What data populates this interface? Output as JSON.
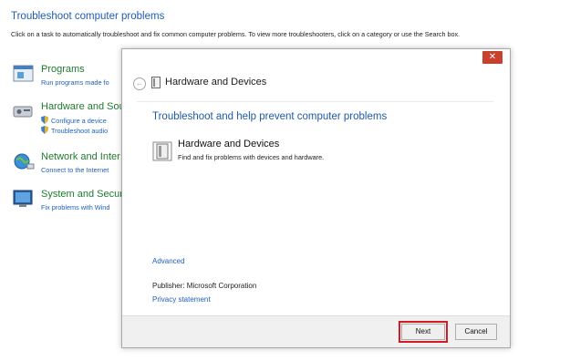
{
  "page": {
    "title": "Troubleshoot computer problems",
    "subtitle": "Click on a task to automatically troubleshoot and fix common computer problems. To view more troubleshooters, click on a category or use the Search box."
  },
  "categories": [
    {
      "title": "Programs",
      "links": [
        "Run programs made fo"
      ]
    },
    {
      "title": "Hardware and Sou",
      "links": [
        "Configure a device",
        "Troubleshoot audio"
      ]
    },
    {
      "title": "Network and Inter",
      "links": [
        "Connect to the Internet"
      ]
    },
    {
      "title": "System and Secur",
      "links": [
        "Fix problems with Wind"
      ]
    }
  ],
  "dialog": {
    "close_glyph": "✕",
    "back_glyph": "←",
    "title": "Hardware and Devices",
    "heading": "Troubleshoot and help prevent computer problems",
    "item_name": "Hardware and Devices",
    "item_desc": "Find and fix problems with devices and hardware.",
    "advanced": "Advanced",
    "publisher": "Publisher:  Microsoft Corporation",
    "privacy": "Privacy statement",
    "next": "Next",
    "cancel": "Cancel"
  },
  "colors": {
    "accent": "#1e5cb3",
    "category": "#1f7a2e",
    "highlight": "#d11c24"
  }
}
